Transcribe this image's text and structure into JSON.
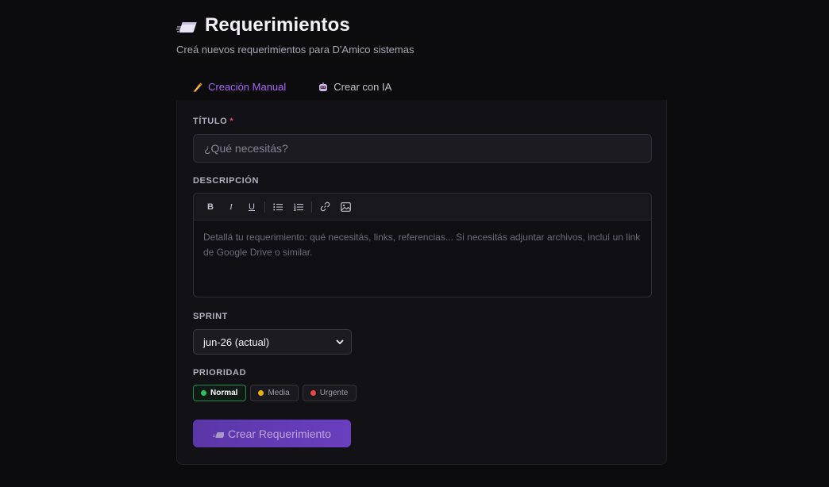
{
  "header": {
    "title": "Requerimientos",
    "subtitle": "Creá nuevos requerimientos para D'Amico sistemas",
    "title_icon": "memo-icon"
  },
  "tabs": [
    {
      "label": "Creación Manual",
      "icon": "writing-hand-icon",
      "active": true
    },
    {
      "label": "Crear con IA",
      "icon": "robot-icon",
      "active": false
    }
  ],
  "form": {
    "title_label": "TÍTULO",
    "required_mark": "*",
    "title_placeholder": "¿Qué necesitás?",
    "title_value": "",
    "description_label": "DESCRIPCIÓN",
    "description_placeholder": "Detallá tu requerimiento: qué necesitás, links, referencias... Si necesitás adjuntar archivos, incluí un link de Google Drive o similar.",
    "toolbar": {
      "bold": "B",
      "italic": "I",
      "underline": "U"
    },
    "sprint_label": "SPRINT",
    "sprint_value": "jun-26 (actual)",
    "priority_label": "PRIORIDAD",
    "priorities": [
      {
        "label": "Normal",
        "color": "#22c55e",
        "selected": true
      },
      {
        "label": "Media",
        "color": "#eab308",
        "selected": false
      },
      {
        "label": "Urgente",
        "color": "#ef4444",
        "selected": false
      }
    ],
    "submit_label": "Crear Requerimiento"
  },
  "colors": {
    "accent": "#8b52e8",
    "background": "#0c0b0e",
    "card": "#121116"
  }
}
